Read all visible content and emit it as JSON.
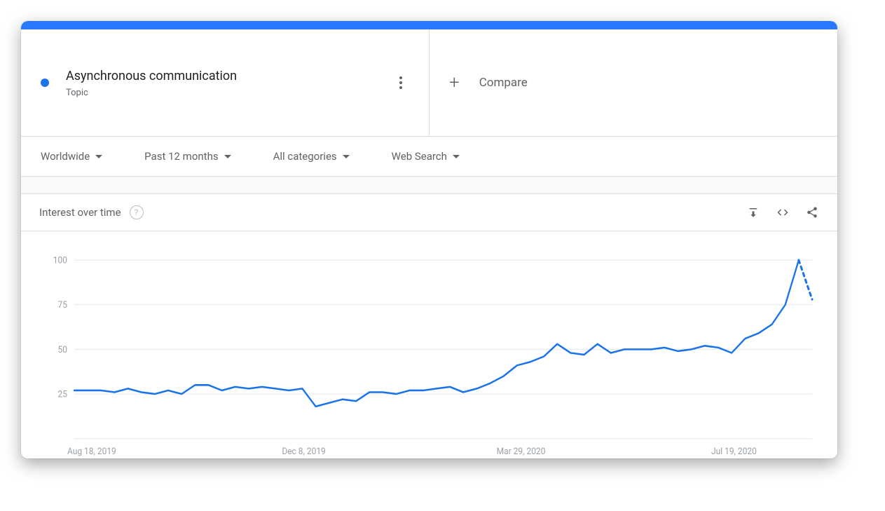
{
  "colors": {
    "accent": "#1a73e8",
    "bar": "#2979ff"
  },
  "topic": {
    "title": "Asynchronous communication",
    "subtitle": "Topic"
  },
  "compare": {
    "label": "Compare"
  },
  "filters": {
    "region": "Worldwide",
    "time": "Past 12 months",
    "category": "All categories",
    "search_type": "Web Search"
  },
  "card": {
    "title": "Interest over time"
  },
  "chart_data": {
    "type": "line",
    "title": "Interest over time",
    "xlabel": "",
    "ylabel": "",
    "ylim": [
      0,
      100
    ],
    "y_ticks": [
      25,
      50,
      75,
      100
    ],
    "x_ticks": [
      "Aug 18, 2019",
      "Dec 8, 2019",
      "Mar 29, 2020",
      "Jul 19, 2020"
    ],
    "x_tick_indices": [
      0,
      16,
      32,
      48
    ],
    "values": [
      27,
      27,
      27,
      26,
      28,
      26,
      25,
      27,
      25,
      30,
      30,
      27,
      29,
      28,
      29,
      28,
      27,
      28,
      18,
      20,
      22,
      21,
      26,
      26,
      25,
      27,
      27,
      28,
      29,
      26,
      28,
      31,
      35,
      41,
      43,
      46,
      53,
      48,
      47,
      53,
      48,
      50,
      50,
      50,
      51,
      49,
      50,
      52,
      51,
      48,
      56,
      59,
      64,
      75,
      100
    ],
    "forecast_last": 78
  }
}
